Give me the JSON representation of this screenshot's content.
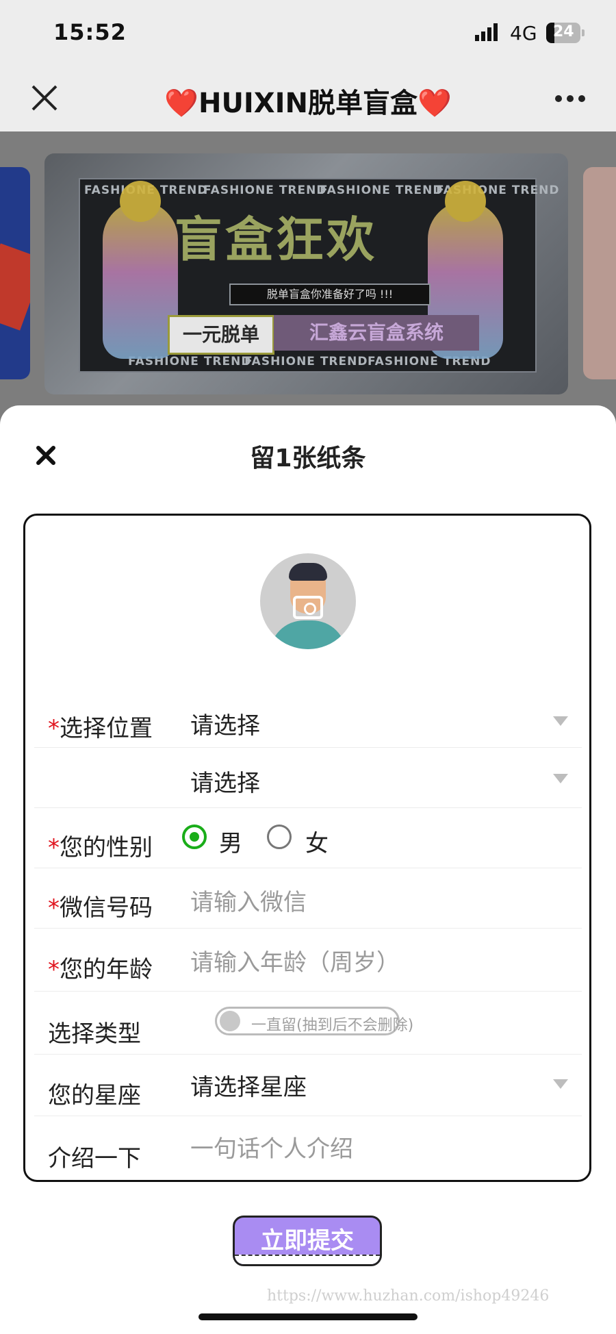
{
  "status_bar": {
    "time": "15:52",
    "network": "4G",
    "battery": "24"
  },
  "nav": {
    "title": "HUIXIN脱单盲盒",
    "heart": "❤️"
  },
  "banner": {
    "trend_text": "FASHIONE TREND",
    "headline": "盲盒狂欢",
    "subtitle": "脱单盲盒你准备好了吗 !!!",
    "cta_left": "一元脱单",
    "cta_right": "汇鑫云盲盒系统"
  },
  "sheet": {
    "title": "留1张纸条"
  },
  "form": {
    "location": {
      "label": "选择位置",
      "required": "*",
      "province_value": "请选择",
      "city_value": "请选择"
    },
    "gender": {
      "label": "您的性别",
      "required": "*",
      "options": [
        "男",
        "女"
      ],
      "selected": "男"
    },
    "wechat": {
      "label": "微信号码",
      "required": "*",
      "placeholder": "请输入微信"
    },
    "age": {
      "label": "您的年龄",
      "required": "*",
      "placeholder": "请输入年龄（周岁）"
    },
    "type": {
      "label": "选择类型",
      "toggle_text": "一直留(抽到后不会删除)",
      "enabled": false
    },
    "zodiac": {
      "label": "您的星座",
      "value": "请选择星座"
    },
    "intro": {
      "label": "介绍一下",
      "placeholder": "一句话个人介绍"
    }
  },
  "submit": {
    "label": "立即提交"
  },
  "watermark": "https://www.huzhan.com/ishop49246",
  "colors": {
    "accent_green": "#1aad19",
    "required_red": "#e0141e",
    "submit_purple": "#a98cf2",
    "heart_red": "#e0141e"
  }
}
